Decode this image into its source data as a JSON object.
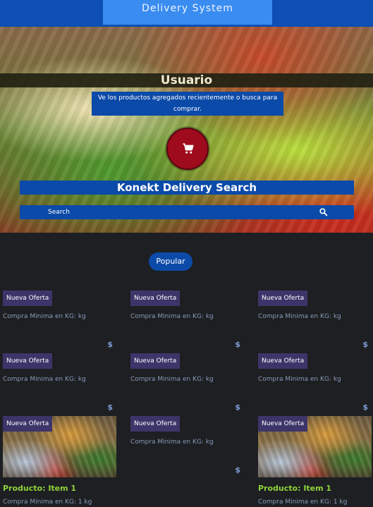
{
  "header": {
    "title": "Delivery System"
  },
  "hero": {
    "user_label": "Usuario",
    "subtitle": "Ve los productos agregados recientemente o busca para comprar.",
    "search_title": "Konekt Delivery Search",
    "search_placeholder": "Search"
  },
  "popular_label": "Popular",
  "cards": [
    {
      "badge": "Nueva Oferta",
      "min": "Compra Minima en KG: kg",
      "price": "$"
    },
    {
      "badge": "Nueva Oferta",
      "min": "Compra Minima en KG: kg",
      "price": "$"
    },
    {
      "badge": "Nueva Oferta",
      "min": "Compra Minima en KG: kg",
      "price": "$"
    },
    {
      "badge": "Nueva Oferta",
      "min": "Compra Minima en KG: kg",
      "price": "$"
    },
    {
      "badge": "Nueva Oferta",
      "min": "Compra Minima en KG: kg",
      "price": "$"
    },
    {
      "badge": "Nueva Oferta",
      "min": "Compra Minima en KG: kg",
      "price": "$"
    },
    {
      "badge": "Nueva Oferta",
      "title": "Producto: Item 1",
      "min": "Compra Minima en KG: 1 kg"
    },
    {
      "badge": "Nueva Oferta",
      "min": "Compra Minima en KG: kg",
      "price": "$"
    },
    {
      "badge": "Nueva Oferta",
      "title": "Producto: Item 1",
      "min": "Compra Minima en KG: 1 kg"
    }
  ],
  "icons": {
    "cart": "shopping-cart-icon",
    "search": "search-icon"
  },
  "colors": {
    "topbar": "#0e4fb3",
    "accent": "#0b4aa8",
    "cart_button": "#9e0b1c",
    "badge": "#3d3569",
    "product_title": "#8fd33a",
    "background": "#1d1f22"
  }
}
